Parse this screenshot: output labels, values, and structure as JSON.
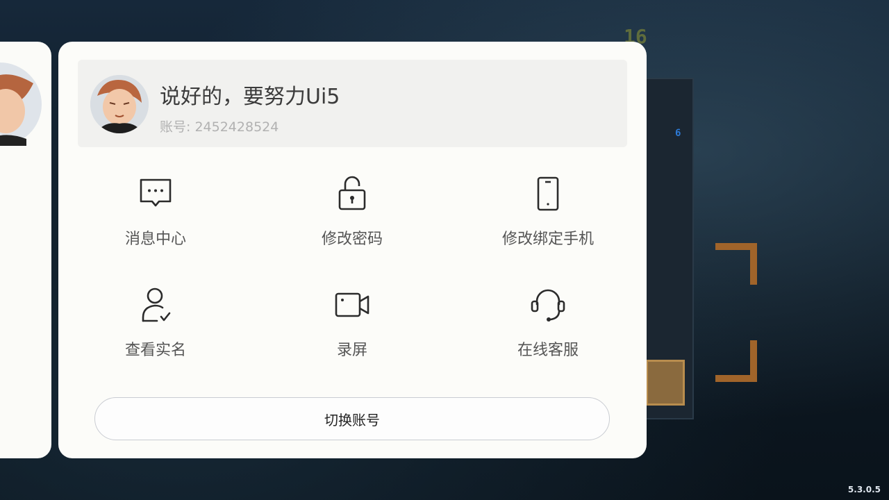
{
  "game": {
    "counter": "16",
    "mini_counter": "6",
    "version": "5.3.0.5"
  },
  "profile": {
    "nickname": "说好的，要努力Ui5",
    "account_label": "账号:",
    "account_number": "2452428524"
  },
  "menu": [
    {
      "label": "消息中心",
      "icon": "message-icon"
    },
    {
      "label": "修改密码",
      "icon": "unlock-icon"
    },
    {
      "label": "修改绑定手机",
      "icon": "phone-icon"
    },
    {
      "label": "查看实名",
      "icon": "user-check-icon"
    },
    {
      "label": "录屏",
      "icon": "video-icon"
    },
    {
      "label": "在线客服",
      "icon": "headset-icon"
    }
  ],
  "switch_button": "切换账号",
  "colors": {
    "modal_bg": "#fcfcf9",
    "card_bg": "#f1f1ef",
    "icon_stroke": "#2b2b2b"
  }
}
